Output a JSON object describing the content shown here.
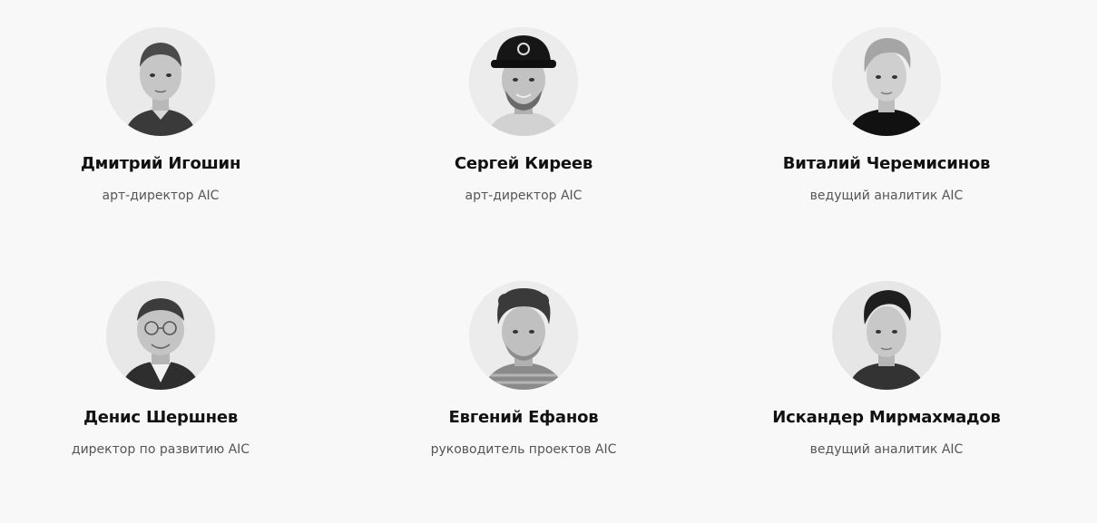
{
  "colors": {
    "background": "#f8f8f8",
    "name_text": "#111111",
    "role_text": "#555555"
  },
  "team": [
    {
      "name": "Дмитрий Игошин",
      "role": "арт-директор AIC",
      "avatar": "person-photo"
    },
    {
      "name": "Сергей Киреев",
      "role": "арт-директор AIC",
      "avatar": "person-photo"
    },
    {
      "name": "Виталий Черемисинов",
      "role": "ведущий аналитик AIC",
      "avatar": "person-photo"
    },
    {
      "name": "Денис Шершнев",
      "role": "директор по развитию AIC",
      "avatar": "person-photo"
    },
    {
      "name": "Евгений Ефанов",
      "role": "руководитель проектов AIC",
      "avatar": "person-photo"
    },
    {
      "name": "Искандер Мирмахмадов",
      "role": "ведущий аналитик AIC",
      "avatar": "person-photo"
    }
  ]
}
